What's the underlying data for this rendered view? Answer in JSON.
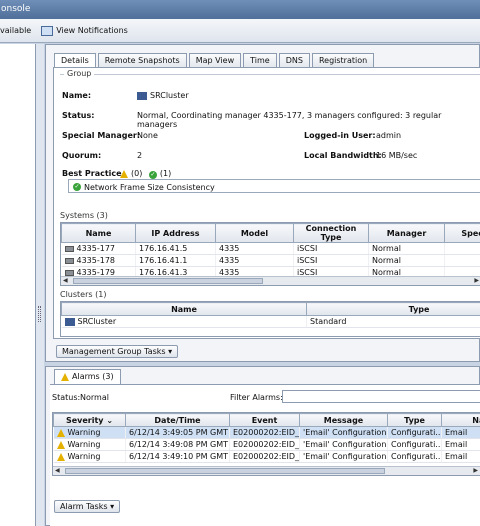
{
  "window": {
    "title_fragment": "onsole"
  },
  "toolbar": {
    "available_label": "vailable",
    "view_notifications_label": "View Notifications"
  },
  "top_tabs": [
    "Details",
    "Remote Snapshots",
    "Map View",
    "Time",
    "DNS",
    "Registration"
  ],
  "group": {
    "legend": "Group",
    "name_label": "Name:",
    "name_value": "SRCluster",
    "status_label": "Status:",
    "status_value": "Normal, Coordinating manager 4335-177, 3 managers configured: 3 regular managers",
    "special_manager_label": "Special Manager:",
    "special_manager_value": "None",
    "logged_in_label": "Logged-in User:",
    "logged_in_value": "admin",
    "quorum_label": "Quorum:",
    "quorum_value": "2",
    "local_bandwidth_label": "Local Bandwidth:",
    "local_bandwidth_value": "16 MB/sec",
    "best_practice_label": "Best Practice",
    "bp_warn_count": "(0)",
    "bp_ok_count": "(1)",
    "bp_item": "Network Frame Size Consistency"
  },
  "systems": {
    "title": "Systems (3)",
    "columns": [
      "Name",
      "IP Address",
      "Model",
      "Connection Type",
      "Manager",
      "Special M"
    ],
    "rows": [
      [
        "4335-177",
        "176.16.41.5",
        "4335",
        "iSCSI",
        "Normal",
        ""
      ],
      [
        "4335-178",
        "176.16.41.1",
        "4335",
        "iSCSI",
        "Normal",
        ""
      ],
      [
        "4335-179",
        "176.16.41.3",
        "4335",
        "iSCSI",
        "Normal",
        ""
      ]
    ]
  },
  "clusters": {
    "title": "Clusters (1)",
    "columns": [
      "Name",
      "Type"
    ],
    "rows": [
      [
        "SRCluster",
        "Standard"
      ]
    ]
  },
  "management_group_tasks": "Management Group Tasks",
  "alarms": {
    "tab_label": "Alarms (3)",
    "status_label": "Status:",
    "status_value": "Normal",
    "filter_label": "Filter Alarms:",
    "columns": [
      "Severity",
      "Date/Time",
      "Event",
      "Message",
      "Type",
      "Nam"
    ],
    "rows": [
      [
        "Warning",
        "6/12/14 3:49:05 PM GMT",
        "E02000202:EID_...",
        "'Email' Configuration S...",
        "Configurati...",
        "Email"
      ],
      [
        "Warning",
        "6/12/14 3:49:08 PM GMT",
        "E02000202:EID_...",
        "'Email' Configuration S...",
        "Configurati...",
        "Email"
      ],
      [
        "Warning",
        "6/12/14 3:49:10 PM GMT",
        "E02000202:EID_...",
        "'Email' Configuration S...",
        "Configurati...",
        "Email"
      ]
    ],
    "tasks_label": "Alarm Tasks"
  },
  "colors": {
    "selected_row": "#cfe0f5",
    "warning": "#e5b100",
    "ok": "#39a33a"
  }
}
